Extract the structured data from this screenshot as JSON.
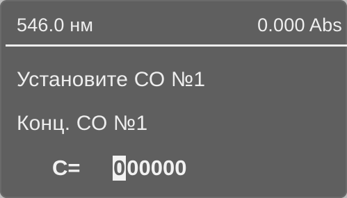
{
  "status": {
    "wavelength": "546.0 нм",
    "absorbance": "0.000 Abs"
  },
  "messages": {
    "line1": "Установите СО №1",
    "line2": "Конц. СО №1"
  },
  "entry": {
    "label": "C=",
    "cursor_digit": "0",
    "remaining_digits": "00000"
  },
  "colors": {
    "screen_bg": "#5f5f5f",
    "text": "#eeeeee"
  }
}
